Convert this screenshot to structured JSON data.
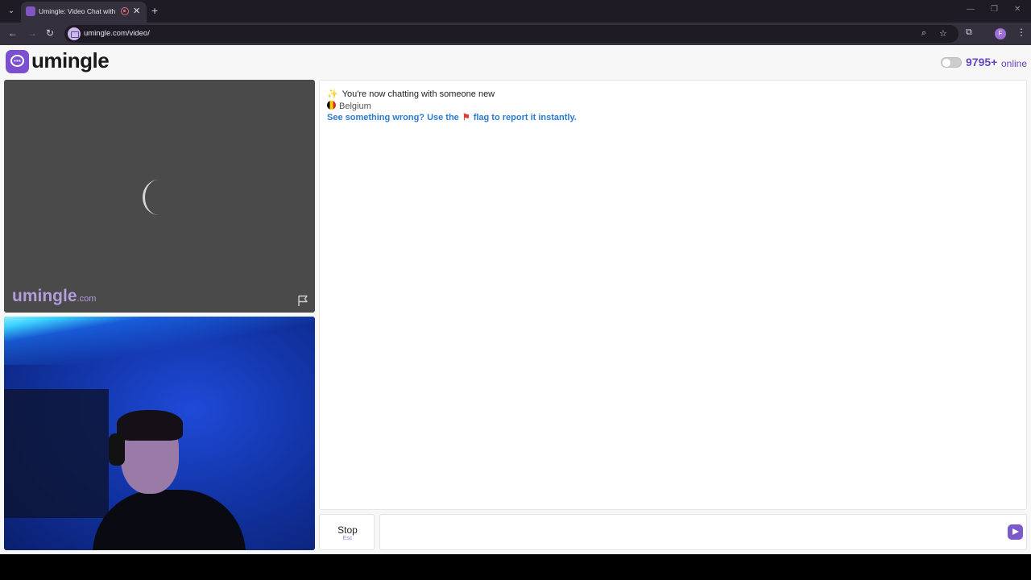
{
  "browser": {
    "tab_title": "Umingle: Video Chat with S",
    "url": "umingle.com/video/",
    "profile_initial": "F"
  },
  "header": {
    "logo_text": "umingle",
    "online_count": "9795+",
    "online_label": "online"
  },
  "stranger_video": {
    "brand": "umingle",
    "brand_suffix": ".com"
  },
  "chat": {
    "status_message": "You're now chatting with someone new",
    "country": "Belgium",
    "warning_before": "See something wrong? Use the",
    "warning_after": "flag to report it instantly."
  },
  "controls": {
    "stop_label": "Stop",
    "stop_shortcut": "Esc",
    "message_placeholder": ""
  },
  "colors": {
    "brand": "#7b4fd0",
    "accent_text": "#6a46c2",
    "link": "#2b7bd0"
  }
}
